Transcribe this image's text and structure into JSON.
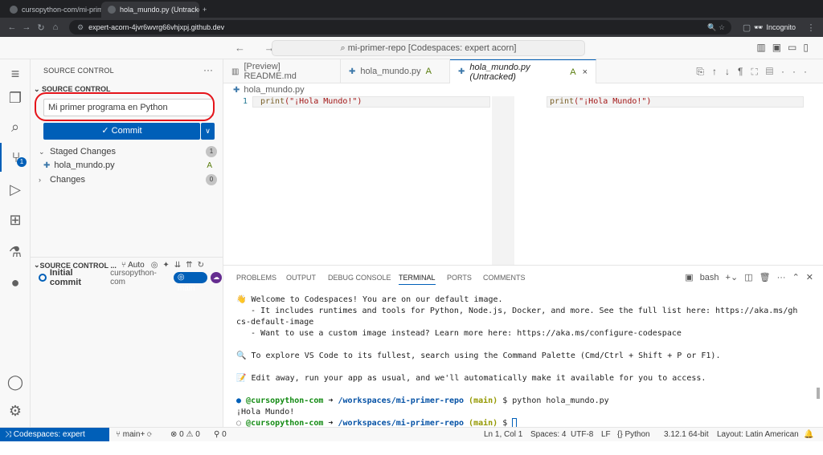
{
  "browser": {
    "tabs": [
      {
        "label": "cursopython-com/mi-primer-rep",
        "close": "×"
      },
      {
        "label": "hola_mundo.py (Untracked) (Wi",
        "close": "×"
      }
    ],
    "new_tab": "+",
    "url": "expert-acorn-4jvr6wvrg66vhjxpj.github.dev",
    "incognito_label": "Incognito"
  },
  "titlebar": {
    "command_center": "mi-primer-repo [Codespaces: expert acorn]"
  },
  "sidebar": {
    "title": "SOURCE CONTROL",
    "more": "···",
    "section_header": "SOURCE CONTROL",
    "commit_message": "Mi primer programa en Python",
    "commit_button": "✓ Commit",
    "commit_dropdown": "∨",
    "staged_label": "Staged Changes",
    "staged_count": "1",
    "staged_file": "hola_mundo.py",
    "staged_file_status": "A",
    "changes_label": "Changes",
    "changes_count": "0",
    "graph": {
      "header": "SOURCE CONTROL ...",
      "auto": "Auto",
      "commit_title": "Initial commit",
      "author": "cursopython-com",
      "branch": "main"
    }
  },
  "activity": {
    "scm_badge": "1"
  },
  "editor": {
    "tabs": [
      {
        "label": "[Preview] README.md"
      },
      {
        "label": "hola_mundo.py",
        "badge": "A"
      },
      {
        "label": "hola_mundo.py (Untracked)",
        "badge": "A",
        "close": "×"
      }
    ],
    "breadcrumb": "hola_mundo.py",
    "left": {
      "line_number": "1",
      "func": "print",
      "string": "(\"¡Hola Mundo!\")"
    },
    "right": {
      "line_number": "1",
      "func": "print",
      "string": "(\"¡Hola Mundo!\")"
    }
  },
  "panel": {
    "tabs": [
      "PROBLEMS",
      "OUTPUT",
      "DEBUG CONSOLE",
      "TERMINAL",
      "PORTS",
      "COMMENTS"
    ],
    "active_tab": "TERMINAL",
    "shell": "bash",
    "terminal": {
      "l1": "👋 Welcome to Codespaces! You are on our default image.",
      "l2": "   - It includes runtimes and tools for Python, Node.js, Docker, and more. See the full list here: https://aka.ms/gh",
      "l3": "cs-default-image",
      "l4": "   - Want to use a custom image instead? Learn more here: https://aka.ms/configure-codespace",
      "l5": "🔍 To explore VS Code to its fullest, search using the Command Palette (Cmd/Ctrl + Shift + P or F1).",
      "l6": "📝 Edit away, run your app as usual, and we'll automatically make it available for you to access.",
      "prompt_user": "@cursopython-com",
      "prompt_arrow": "➜",
      "prompt_path": "/workspaces/mi-primer-repo",
      "prompt_branch": "(main)",
      "cmd1": "$ python hola_mundo.py",
      "output": "¡Hola Mundo!",
      "cmd2": "$"
    }
  },
  "statusbar": {
    "remote": "Codespaces: expert acorn",
    "branch": "main+",
    "errors": "0",
    "warnings": "0",
    "ports": "0",
    "position": "Ln 1, Col 1",
    "spaces": "Spaces: 4",
    "encoding": "UTF-8",
    "eol": "LF",
    "language": "Python",
    "interpreter": "3.12.1 64-bit",
    "layout": "Layout: Latin American"
  },
  "colors": {
    "accent": "#005fb8",
    "annotation_red": "#e5141a",
    "added_green": "#587c0c"
  }
}
